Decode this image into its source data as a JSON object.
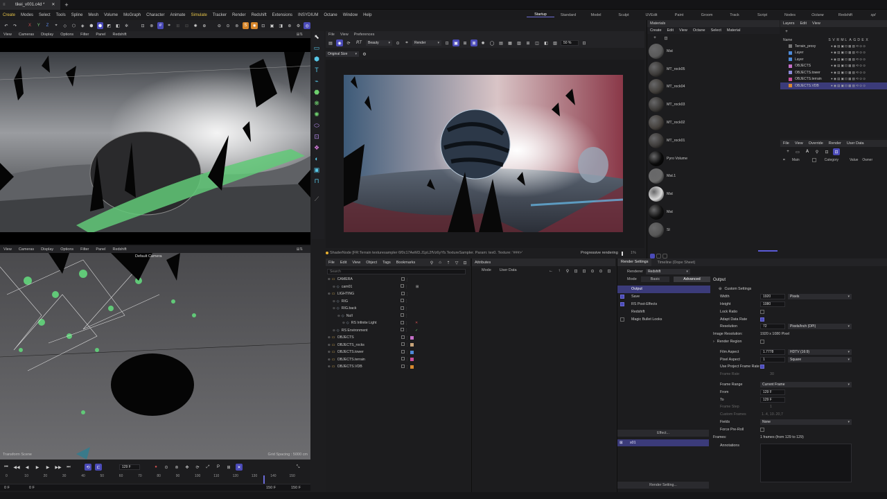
{
  "title_tab": "tikei_v001.c4d *",
  "menu": [
    "Create",
    "Modes",
    "Select",
    "Tools",
    "Spline",
    "Mesh",
    "Volume",
    "MoGraph",
    "Character",
    "Animate",
    "Simulate",
    "Tracker",
    "Render",
    "Redshift",
    "Extensions",
    "INSYDIUM",
    "Octane",
    "Window",
    "Help"
  ],
  "layouts": [
    "Startup",
    "Standard",
    "Model",
    "Sculpt",
    "UVEdit",
    "Paint",
    "Groom",
    "Track",
    "Script",
    "Nodes",
    "Octane",
    "Redshift",
    "spl"
  ],
  "viewport_menu": [
    "View",
    "Cameras",
    "Display",
    "Options",
    "Filter",
    "Panel",
    "Redshift"
  ],
  "viewport_bottom": {
    "status": "Transform Scene",
    "camera": "Default Camera",
    "grid": "Grid Spacing : 5000 cm"
  },
  "timeline": {
    "current_frame": "129 F",
    "ticks": [
      "0",
      "10",
      "20",
      "30",
      "40",
      "50",
      "60",
      "70",
      "80",
      "90",
      "100",
      "110",
      "120",
      "130",
      "140",
      "150"
    ],
    "start": "0 F",
    "start2": "0 F",
    "end": "150 F",
    "end2": "150 F"
  },
  "render_view": {
    "menu": [
      "File",
      "View",
      "Preferences"
    ],
    "beauty": "Beauty",
    "render": "Render",
    "zoom": "50 %",
    "orig": "Original Size",
    "status": "ShaderNode [FR:Terrain texturesampler 6f0c17AeM3.J1pL2fVz6yYb.TextureSampler. Param: tex0. Texture: '###>'",
    "progress": "Progressive rendering",
    "progress_val": "1%"
  },
  "materials": {
    "title": "Materials",
    "menu": [
      "Create",
      "Edit",
      "View",
      "Octane",
      "Select",
      "Material"
    ],
    "items": [
      {
        "name": "Mat",
        "color": "#5a5a5a"
      },
      {
        "name": "MT_rock05",
        "color": "#3c3a38"
      },
      {
        "name": "MT_rock04",
        "color": "#413e3a"
      },
      {
        "name": "MT_rock03",
        "color": "#3a3836"
      },
      {
        "name": "MT_rock02",
        "color": "#44403c"
      },
      {
        "name": "MT_rock01",
        "color": "#3d3b39"
      },
      {
        "name": "Pyro Volume",
        "color": "#0a0a0a"
      },
      {
        "name": "Mat.1",
        "color": "#6a6a6a"
      },
      {
        "name": "Mat",
        "color": "#d8d8d8"
      },
      {
        "name": "Mat",
        "color": "#111111"
      },
      {
        "name": "Sl",
        "color": "#565656"
      }
    ]
  },
  "layers": {
    "title": "Layers",
    "menu": [
      "Layers",
      "Edit",
      "View"
    ],
    "cols": [
      "Name",
      "S",
      "V",
      "R",
      "M",
      "L",
      "A",
      "G",
      "D",
      "E",
      "X"
    ],
    "items": [
      {
        "name": "Terrain_proxy",
        "color": "#777777"
      },
      {
        "name": "Layer",
        "color": "#4d8ad8"
      },
      {
        "name": "Layer",
        "color": "#4d8ad8"
      },
      {
        "name": "OBJECTS",
        "color": "#c56fc8"
      },
      {
        "name": "OBJECTS.tower",
        "color": "#8a8ad8"
      },
      {
        "name": "OBJECTS.terrain",
        "color": "#c84f9a"
      },
      {
        "name": "OBJECTS.VDB",
        "color": "#d88a2f"
      }
    ]
  },
  "takes": {
    "menu": [
      "File",
      "View",
      "Override",
      "Render",
      "User Data"
    ],
    "cols": [
      "Main",
      "Category",
      "Value",
      "Owner"
    ]
  },
  "objects": {
    "menu": [
      "File",
      "Edit",
      "View",
      "Object",
      "Tags",
      "Bookmarks"
    ],
    "search": "Search",
    "items": [
      {
        "name": "CAMERA",
        "indent": 0,
        "folder": true,
        "color": "#aaaaaa"
      },
      {
        "name": "cam01",
        "indent": 1,
        "folder": false,
        "color": "#aaaaaa"
      },
      {
        "name": "LIGHTING",
        "indent": 0,
        "folder": true,
        "color": "#aaaaaa"
      },
      {
        "name": "RIG",
        "indent": 1,
        "folder": false,
        "color": "#aaaaaa"
      },
      {
        "name": "RIG.back",
        "indent": 1,
        "folder": false,
        "color": "#aaaaaa"
      },
      {
        "name": "Null",
        "indent": 2,
        "folder": false,
        "color": "#aaaaaa"
      },
      {
        "name": "RS Infinite Light",
        "indent": 3,
        "folder": false,
        "color": "#aaaaaa"
      },
      {
        "name": "RS Environment",
        "indent": 1,
        "folder": false,
        "color": "#aaaaaa"
      },
      {
        "name": "OBJECTS",
        "indent": 0,
        "folder": true,
        "color": "#c56fc8"
      },
      {
        "name": "OBJECTS_rocks",
        "indent": 0,
        "folder": true,
        "color": "#c8a47a"
      },
      {
        "name": "OBJECTS.tower",
        "indent": 0,
        "folder": true,
        "color": "#4d8ad8"
      },
      {
        "name": "OBJECTS.terrain",
        "indent": 0,
        "folder": true,
        "color": "#c84f9a"
      },
      {
        "name": "OBJECTS.VDB",
        "indent": 0,
        "folder": true,
        "color": "#d88a2f"
      }
    ]
  },
  "attributes": {
    "title": "Attributes",
    "mode": "Mode",
    "user_data": "User Data"
  },
  "render_settings": {
    "tab1": "Render Settings",
    "tab2": "Timeline (Dope Sheet)",
    "renderer_label": "Renderer",
    "renderer": "Redshift",
    "mode_label": "Mode",
    "basic": "Basic",
    "advanced": "Advanced",
    "list": [
      {
        "label": "Output",
        "checked": false,
        "selected": true,
        "cb": false
      },
      {
        "label": "Save",
        "checked": true,
        "selected": false,
        "cb": true
      },
      {
        "label": "RS Post-Effects",
        "checked": true,
        "selected": false,
        "cb": true
      },
      {
        "label": "Redshift",
        "checked": false,
        "selected": false,
        "cb": false
      },
      {
        "label": "Magic Bullet Looks",
        "checked": false,
        "selected": false,
        "cb": true
      }
    ],
    "effect": "Effect...",
    "preset": "s01",
    "render_setting_btn": "Render Setting...",
    "output_title": "Output",
    "custom": "Custom Settings",
    "width_l": "Width",
    "width": "1920",
    "width_unit": "Pixels",
    "height_l": "Height",
    "height": "1080",
    "lock_l": "Lock Ratio",
    "adapt_l": "Adapt Data Rate",
    "res_l": "Resolution",
    "res": "72",
    "res_unit": "Pixels/Inch (DPI)",
    "imgres_l": "Image Resolution:",
    "imgres": "1920 x 1080 Pixel",
    "region_l": "Render Region",
    "film_l": "Film Aspect",
    "film": "1.7778",
    "film_dd": "HDTV (16:9)",
    "pixel_l": "Pixel Aspect",
    "pixel": "1",
    "pixel_dd": "Square",
    "useproj_l": "Use Project Frame Rate",
    "framerate_l": "Frame Rate",
    "framerate": "30",
    "range_l": "Frame Range",
    "range": "Current Frame",
    "from_l": "From",
    "from": "129 F",
    "to_l": "To",
    "to": "129 F",
    "step_l": "Frame Step",
    "step": "1",
    "custom_frames_l": "Custom Frames",
    "custom_frames": "1..4, 10..20,7",
    "fields_l": "Fields",
    "fields": "None",
    "preroll_l": "Force Pre-Roll",
    "frames_l": "Frames:",
    "frames": "1 frames (from 129 to 129)",
    "annotations_l": "Annotations"
  }
}
